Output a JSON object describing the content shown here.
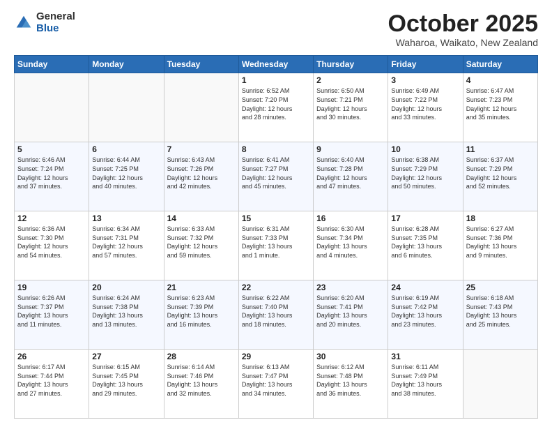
{
  "logo": {
    "general": "General",
    "blue": "Blue"
  },
  "header": {
    "month": "October 2025",
    "location": "Waharoa, Waikato, New Zealand"
  },
  "days_of_week": [
    "Sunday",
    "Monday",
    "Tuesday",
    "Wednesday",
    "Thursday",
    "Friday",
    "Saturday"
  ],
  "weeks": [
    [
      {
        "day": "",
        "info": ""
      },
      {
        "day": "",
        "info": ""
      },
      {
        "day": "",
        "info": ""
      },
      {
        "day": "1",
        "info": "Sunrise: 6:52 AM\nSunset: 7:20 PM\nDaylight: 12 hours\nand 28 minutes."
      },
      {
        "day": "2",
        "info": "Sunrise: 6:50 AM\nSunset: 7:21 PM\nDaylight: 12 hours\nand 30 minutes."
      },
      {
        "day": "3",
        "info": "Sunrise: 6:49 AM\nSunset: 7:22 PM\nDaylight: 12 hours\nand 33 minutes."
      },
      {
        "day": "4",
        "info": "Sunrise: 6:47 AM\nSunset: 7:23 PM\nDaylight: 12 hours\nand 35 minutes."
      }
    ],
    [
      {
        "day": "5",
        "info": "Sunrise: 6:46 AM\nSunset: 7:24 PM\nDaylight: 12 hours\nand 37 minutes."
      },
      {
        "day": "6",
        "info": "Sunrise: 6:44 AM\nSunset: 7:25 PM\nDaylight: 12 hours\nand 40 minutes."
      },
      {
        "day": "7",
        "info": "Sunrise: 6:43 AM\nSunset: 7:26 PM\nDaylight: 12 hours\nand 42 minutes."
      },
      {
        "day": "8",
        "info": "Sunrise: 6:41 AM\nSunset: 7:27 PM\nDaylight: 12 hours\nand 45 minutes."
      },
      {
        "day": "9",
        "info": "Sunrise: 6:40 AM\nSunset: 7:28 PM\nDaylight: 12 hours\nand 47 minutes."
      },
      {
        "day": "10",
        "info": "Sunrise: 6:38 AM\nSunset: 7:29 PM\nDaylight: 12 hours\nand 50 minutes."
      },
      {
        "day": "11",
        "info": "Sunrise: 6:37 AM\nSunset: 7:29 PM\nDaylight: 12 hours\nand 52 minutes."
      }
    ],
    [
      {
        "day": "12",
        "info": "Sunrise: 6:36 AM\nSunset: 7:30 PM\nDaylight: 12 hours\nand 54 minutes."
      },
      {
        "day": "13",
        "info": "Sunrise: 6:34 AM\nSunset: 7:31 PM\nDaylight: 12 hours\nand 57 minutes."
      },
      {
        "day": "14",
        "info": "Sunrise: 6:33 AM\nSunset: 7:32 PM\nDaylight: 12 hours\nand 59 minutes."
      },
      {
        "day": "15",
        "info": "Sunrise: 6:31 AM\nSunset: 7:33 PM\nDaylight: 13 hours\nand 1 minute."
      },
      {
        "day": "16",
        "info": "Sunrise: 6:30 AM\nSunset: 7:34 PM\nDaylight: 13 hours\nand 4 minutes."
      },
      {
        "day": "17",
        "info": "Sunrise: 6:28 AM\nSunset: 7:35 PM\nDaylight: 13 hours\nand 6 minutes."
      },
      {
        "day": "18",
        "info": "Sunrise: 6:27 AM\nSunset: 7:36 PM\nDaylight: 13 hours\nand 9 minutes."
      }
    ],
    [
      {
        "day": "19",
        "info": "Sunrise: 6:26 AM\nSunset: 7:37 PM\nDaylight: 13 hours\nand 11 minutes."
      },
      {
        "day": "20",
        "info": "Sunrise: 6:24 AM\nSunset: 7:38 PM\nDaylight: 13 hours\nand 13 minutes."
      },
      {
        "day": "21",
        "info": "Sunrise: 6:23 AM\nSunset: 7:39 PM\nDaylight: 13 hours\nand 16 minutes."
      },
      {
        "day": "22",
        "info": "Sunrise: 6:22 AM\nSunset: 7:40 PM\nDaylight: 13 hours\nand 18 minutes."
      },
      {
        "day": "23",
        "info": "Sunrise: 6:20 AM\nSunset: 7:41 PM\nDaylight: 13 hours\nand 20 minutes."
      },
      {
        "day": "24",
        "info": "Sunrise: 6:19 AM\nSunset: 7:42 PM\nDaylight: 13 hours\nand 23 minutes."
      },
      {
        "day": "25",
        "info": "Sunrise: 6:18 AM\nSunset: 7:43 PM\nDaylight: 13 hours\nand 25 minutes."
      }
    ],
    [
      {
        "day": "26",
        "info": "Sunrise: 6:17 AM\nSunset: 7:44 PM\nDaylight: 13 hours\nand 27 minutes."
      },
      {
        "day": "27",
        "info": "Sunrise: 6:15 AM\nSunset: 7:45 PM\nDaylight: 13 hours\nand 29 minutes."
      },
      {
        "day": "28",
        "info": "Sunrise: 6:14 AM\nSunset: 7:46 PM\nDaylight: 13 hours\nand 32 minutes."
      },
      {
        "day": "29",
        "info": "Sunrise: 6:13 AM\nSunset: 7:47 PM\nDaylight: 13 hours\nand 34 minutes."
      },
      {
        "day": "30",
        "info": "Sunrise: 6:12 AM\nSunset: 7:48 PM\nDaylight: 13 hours\nand 36 minutes."
      },
      {
        "day": "31",
        "info": "Sunrise: 6:11 AM\nSunset: 7:49 PM\nDaylight: 13 hours\nand 38 minutes."
      },
      {
        "day": "",
        "info": ""
      }
    ]
  ]
}
